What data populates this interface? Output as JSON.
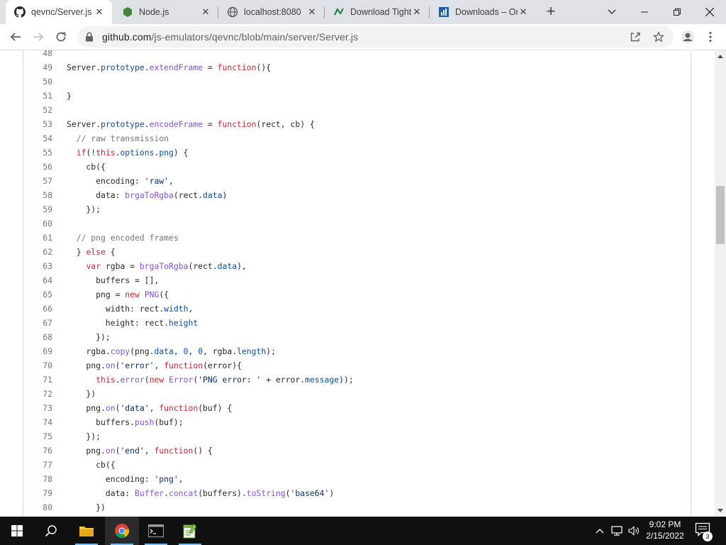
{
  "tabs": [
    {
      "title": "qevnc/Server.js",
      "active": true
    },
    {
      "title": "Node.js",
      "active": false
    },
    {
      "title": "localhost:8080",
      "active": false
    },
    {
      "title": "Download Tight",
      "active": false
    },
    {
      "title": "Downloads – Or",
      "active": false
    }
  ],
  "address_bar": {
    "host": "github.com",
    "path": "/js-emulators/qevnc/blob/main/server/Server.js"
  },
  "code_lines": [
    {
      "num": "48",
      "code": ""
    },
    {
      "num": "49",
      "code": "Server.prototype.extendFrame = function(){"
    },
    {
      "num": "50",
      "code": ""
    },
    {
      "num": "51",
      "code": "}"
    },
    {
      "num": "52",
      "code": ""
    },
    {
      "num": "53",
      "code": "Server.prototype.encodeFrame = function(rect, cb) {"
    },
    {
      "num": "54",
      "code": "  // raw transmission"
    },
    {
      "num": "55",
      "code": "  if(!this.options.png) {"
    },
    {
      "num": "56",
      "code": "    cb({"
    },
    {
      "num": "57",
      "code": "      encoding: 'raw',"
    },
    {
      "num": "58",
      "code": "      data: brgaToRgba(rect.data)"
    },
    {
      "num": "59",
      "code": "    });"
    },
    {
      "num": "60",
      "code": ""
    },
    {
      "num": "61",
      "code": "  // png encoded frames"
    },
    {
      "num": "62",
      "code": "  } else {"
    },
    {
      "num": "63",
      "code": "    var rgba = brgaToRgba(rect.data),"
    },
    {
      "num": "64",
      "code": "      buffers = [],"
    },
    {
      "num": "65",
      "code": "      png = new PNG({"
    },
    {
      "num": "66",
      "code": "        width: rect.width,"
    },
    {
      "num": "67",
      "code": "        height: rect.height"
    },
    {
      "num": "68",
      "code": "      });"
    },
    {
      "num": "69",
      "code": "    rgba.copy(png.data, 0, 0, rgba.length);"
    },
    {
      "num": "70",
      "code": "    png.on('error', function(error){"
    },
    {
      "num": "71",
      "code": "      this.error(new Error('PNG error: ' + error.message));"
    },
    {
      "num": "72",
      "code": "    })"
    },
    {
      "num": "73",
      "code": "    png.on('data', function(buf) {"
    },
    {
      "num": "74",
      "code": "      buffers.push(buf);"
    },
    {
      "num": "75",
      "code": "    });"
    },
    {
      "num": "76",
      "code": "    png.on('end', function() {"
    },
    {
      "num": "77",
      "code": "      cb({"
    },
    {
      "num": "78",
      "code": "        encoding: 'png',"
    },
    {
      "num": "79",
      "code": "        data: Buffer.concat(buffers).toString('base64')"
    },
    {
      "num": "80",
      "code": "      })"
    }
  ],
  "taskbar": {
    "time": "9:02 PM",
    "date": "2/15/2022",
    "notification_count": "3"
  },
  "colors": {
    "tabstrip": "#dee1e6",
    "keyword": "#cf222e",
    "entity": "#8250df",
    "constant": "#0550ae",
    "string": "#0a3069",
    "comment": "#6e7781",
    "taskbar": "#101010"
  },
  "icons": {
    "tab_favicons": [
      "github-icon",
      "nodejs-icon",
      "globe-icon",
      "tightvnc-icon",
      "sourceforge-icon"
    ],
    "toolbar": [
      "back-arrow-icon",
      "forward-arrow-icon",
      "reload-icon",
      "lock-icon",
      "share-icon",
      "star-icon",
      "profile-icon",
      "more-menu-icon"
    ],
    "taskbar": [
      "windows-start-icon",
      "search-icon",
      "file-explorer-icon",
      "chrome-icon",
      "terminal-icon",
      "notepad-plus-plus-icon"
    ]
  }
}
